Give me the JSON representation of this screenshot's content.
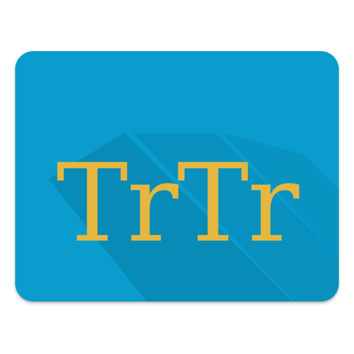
{
  "icon": {
    "label": "TrTr",
    "colors": {
      "background": "#0a9ccc",
      "text": "#e6b740",
      "long_shadow": "#0889b4",
      "page": "#ffffff"
    }
  }
}
